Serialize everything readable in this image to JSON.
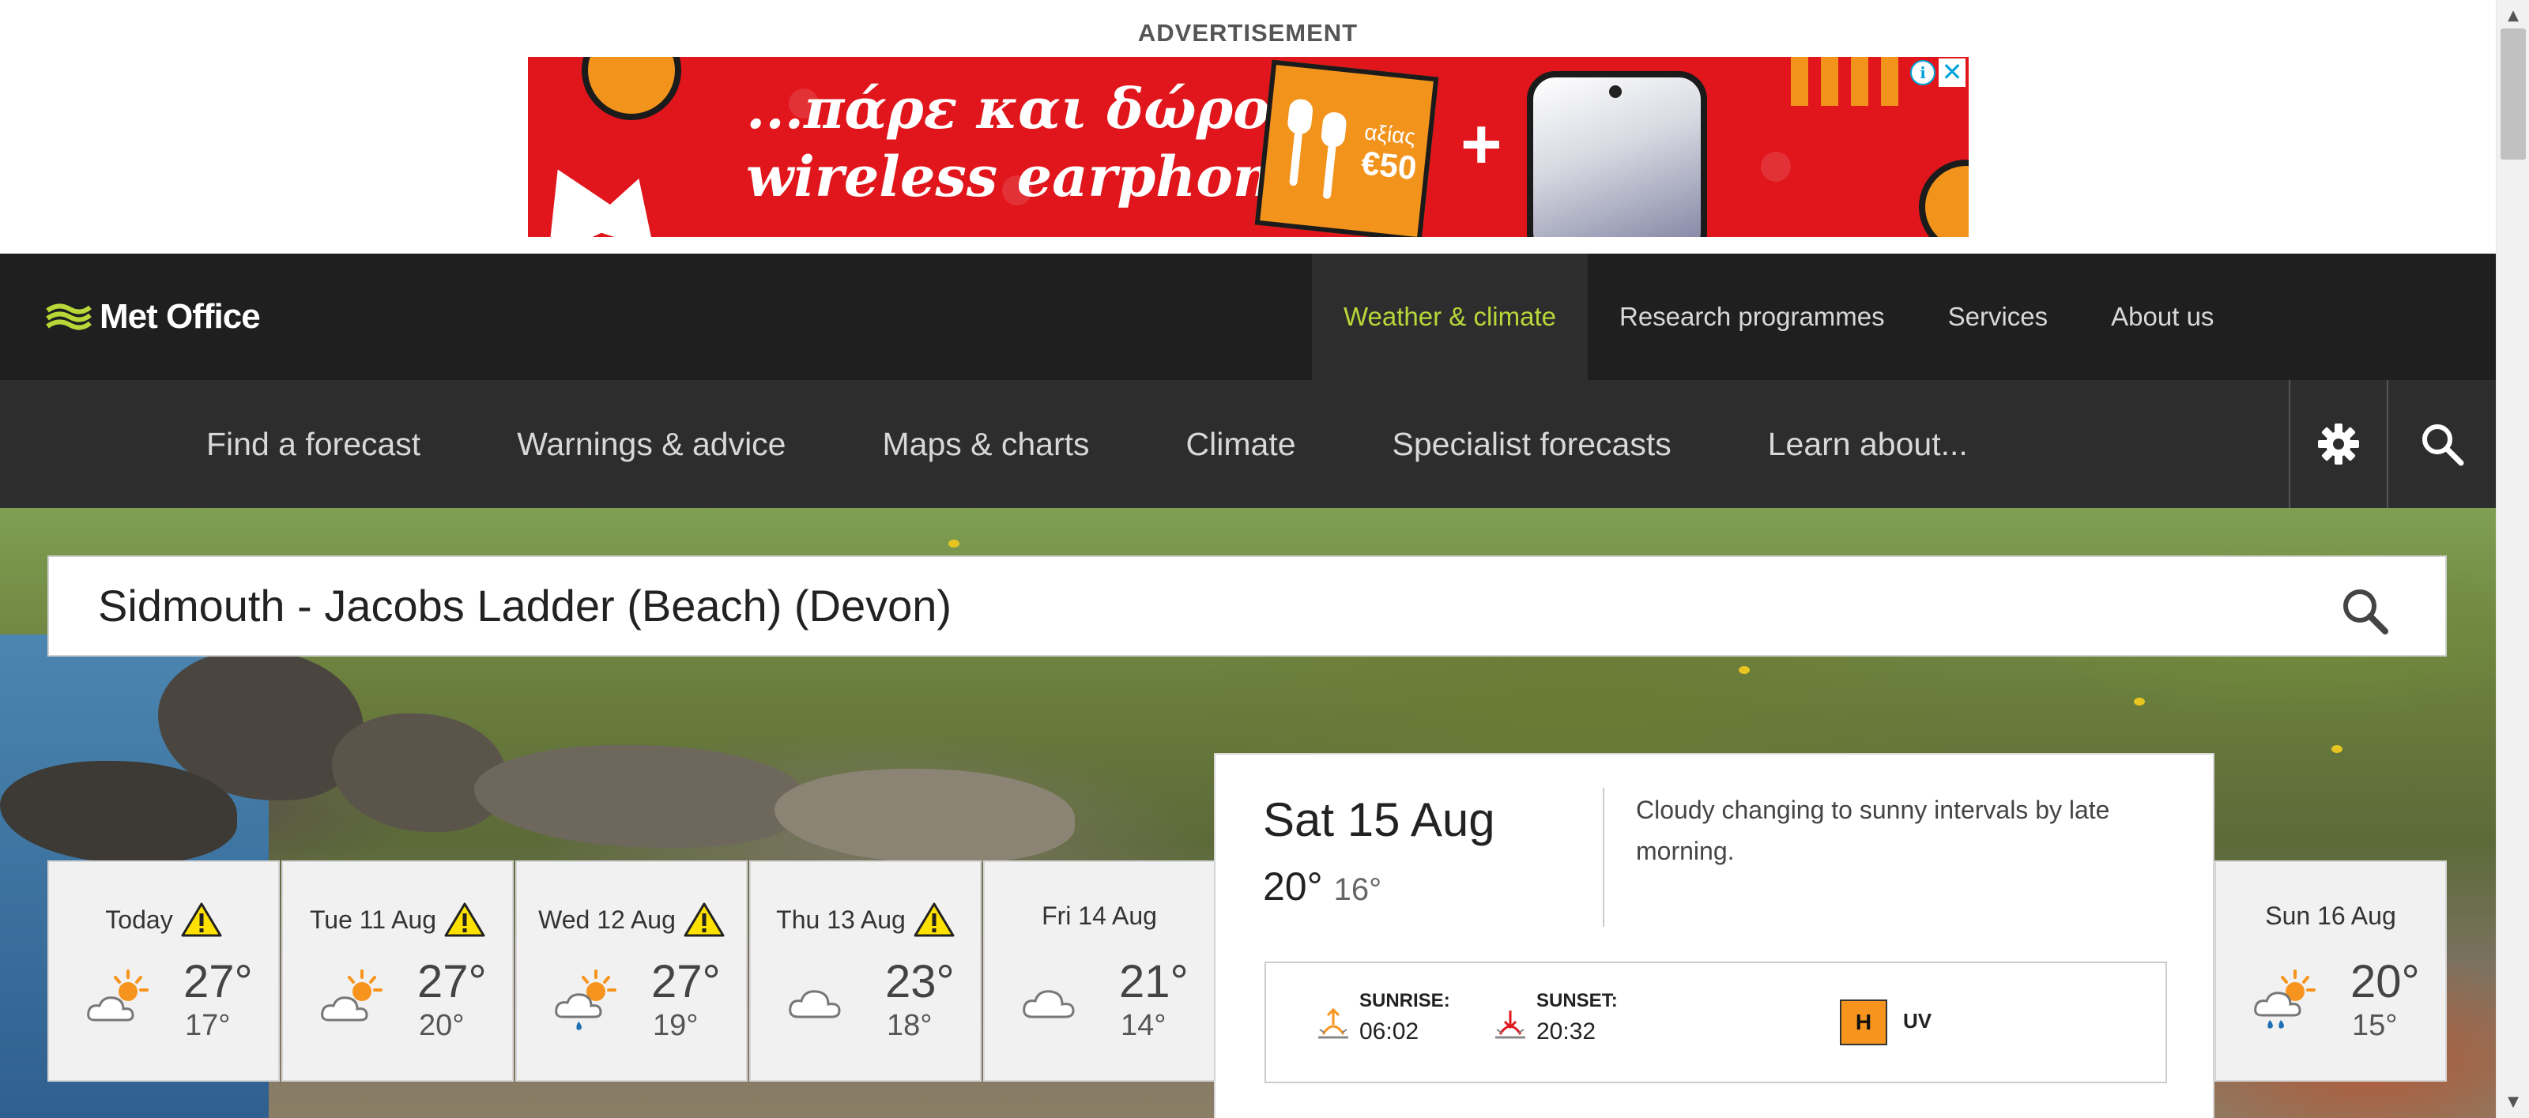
{
  "advertisement": {
    "label": "ADVERTISEMENT",
    "headline_line1": "...πάρε και δώρο",
    "headline_line2": "wireless earphones!",
    "offer_small": "αξίας",
    "offer_value": "€50",
    "plus": "+",
    "info_glyph": "i",
    "close_glyph": "✕",
    "brand_color": "#e0161c",
    "accent_color": "#f2931c"
  },
  "header": {
    "logo_text": "Met Office",
    "logo_icon": "met-office-waves-icon",
    "logo_color": "#b9d739",
    "top_nav": [
      {
        "label": "Weather & climate",
        "active": true
      },
      {
        "label": "Research programmes",
        "active": false
      },
      {
        "label": "Services",
        "active": false
      },
      {
        "label": "About us",
        "active": false
      }
    ],
    "sub_nav": [
      {
        "label": "Find a forecast"
      },
      {
        "label": "Warnings & advice"
      },
      {
        "label": "Maps & charts"
      },
      {
        "label": "Climate"
      },
      {
        "label": "Specialist forecasts"
      },
      {
        "label": "Learn about..."
      }
    ],
    "settings_icon": "gear-icon",
    "search_icon": "search-icon"
  },
  "search": {
    "value": "Sidmouth - Jacobs Ladder (Beach) (Devon)",
    "button_icon": "search-icon"
  },
  "forecast": {
    "days": [
      {
        "name": "Today",
        "warning": true,
        "icon": "sunny-intervals-icon",
        "max": "27°",
        "min": "17°"
      },
      {
        "name": "Tue 11 Aug",
        "warning": true,
        "icon": "sunny-intervals-icon",
        "max": "27°",
        "min": "20°"
      },
      {
        "name": "Wed 12 Aug",
        "warning": true,
        "icon": "light-shower-icon",
        "max": "27°",
        "min": "19°"
      },
      {
        "name": "Thu 13 Aug",
        "warning": true,
        "icon": "cloudy-icon",
        "max": "23°",
        "min": "18°"
      },
      {
        "name": "Fri 14 Aug",
        "warning": false,
        "icon": "cloudy-icon",
        "max": "21°",
        "min": "14°"
      }
    ],
    "selected": {
      "date": "Sat 15 Aug",
      "max": "20°",
      "min": "16°",
      "description": "Cloudy changing to sunny intervals by late morning.",
      "sunrise_label": "SUNRISE:",
      "sunrise": "06:02",
      "sunset_label": "SUNSET:",
      "sunset": "20:32",
      "uv_level": "H",
      "uv_label": "UV",
      "uv_color": "#f7941d"
    },
    "next": {
      "name": "Sun 16 Aug",
      "icon": "heavy-shower-icon",
      "max": "20°",
      "min": "15°"
    }
  }
}
